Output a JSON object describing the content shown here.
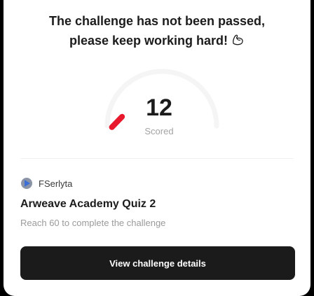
{
  "headline": {
    "line1": "The challenge has not been passed,",
    "line2": "please keep working hard!",
    "icon": "flexed-biceps-icon"
  },
  "score": {
    "value": "12",
    "label": "Scored",
    "target": 60,
    "accent_color": "#e8192c",
    "track_color": "#f5f5f5"
  },
  "author": {
    "name": "FSerlyta",
    "avatar_colors": [
      "#3b6fd6",
      "#8a94a6"
    ]
  },
  "quiz": {
    "title": "Arweave Academy Quiz 2",
    "hint": "Reach 60 to complete the challenge"
  },
  "button": {
    "label": "View challenge details"
  }
}
